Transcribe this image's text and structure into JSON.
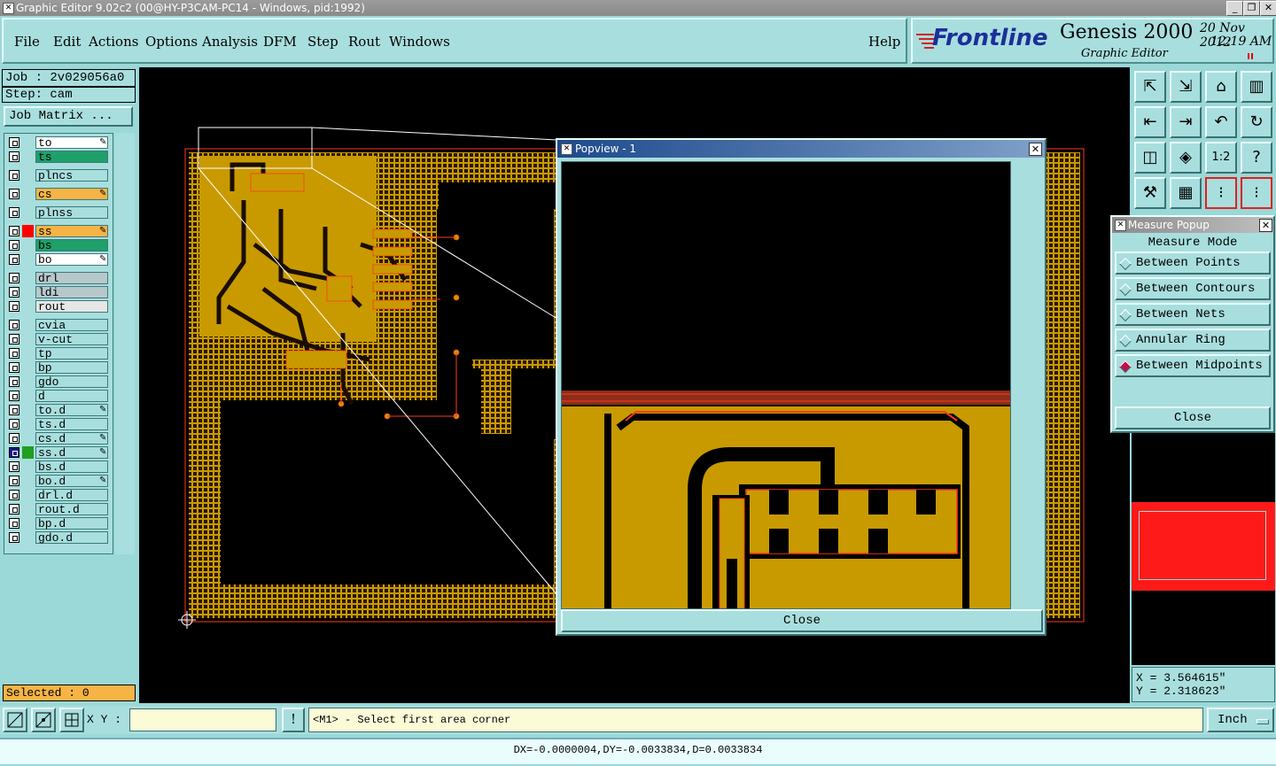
{
  "window": {
    "title": "Graphic Editor 9.02c2 (00@HY-P3CAM-PC14 - Windows, pid:1992)"
  },
  "menu": [
    {
      "label": "File"
    },
    {
      "label": "Edit"
    },
    {
      "label": "Actions"
    },
    {
      "label": "Options"
    },
    {
      "label": "Analysis"
    },
    {
      "label": "DFM"
    },
    {
      "label": "Step"
    },
    {
      "label": "Rout"
    },
    {
      "label": "Windows"
    }
  ],
  "help_label": "Help",
  "brand": {
    "logo": "Frontline",
    "product": "Genesis 2000",
    "subtitle": "Graphic Editor",
    "date": "20 Nov 2012",
    "time": "12:19 AM"
  },
  "job": {
    "job_label": "Job : 2v029056a0",
    "step_label": "Step: cam",
    "matrix_button": "Job Matrix ..."
  },
  "layers": [
    {
      "name": "to",
      "bg": "#ffffff",
      "icon": "pen-icon"
    },
    {
      "name": "ts",
      "bg": "#1fa06a",
      "icon": ""
    },
    {
      "name": "plncs",
      "bg": "#a9dede",
      "icon": ""
    },
    {
      "name": "cs",
      "bg": "#f5b445",
      "icon": "pen-icon"
    },
    {
      "name": "plnss",
      "bg": "#a9dede",
      "icon": ""
    },
    {
      "name": "ss",
      "bg": "#f5b445",
      "icon": "pen-icon",
      "marker": "#ff0000"
    },
    {
      "name": "bs",
      "bg": "#1fa06a",
      "icon": ""
    },
    {
      "name": "bo",
      "bg": "#ffffff",
      "icon": "pen-icon"
    },
    {
      "name": "drl",
      "bg": "#b7c8cc",
      "icon": ""
    },
    {
      "name": "ldi",
      "bg": "#b7c8cc",
      "icon": ""
    },
    {
      "name": "rout",
      "bg": "#e6e6e6",
      "icon": ""
    },
    {
      "name": "cvia",
      "bg": "#a9dede",
      "icon": ""
    },
    {
      "name": "v-cut",
      "bg": "#a9dede",
      "icon": ""
    },
    {
      "name": "tp",
      "bg": "#a9dede",
      "icon": ""
    },
    {
      "name": "bp",
      "bg": "#a9dede",
      "icon": ""
    },
    {
      "name": "gdo",
      "bg": "#a9dede",
      "icon": ""
    },
    {
      "name": "d",
      "bg": "#a9dede",
      "icon": ""
    },
    {
      "name": "to.d",
      "bg": "#a9dede",
      "icon": "pen-icon"
    },
    {
      "name": "ts.d",
      "bg": "#a9dede",
      "icon": ""
    },
    {
      "name": "cs.d",
      "bg": "#a9dede",
      "icon": "pen-icon"
    },
    {
      "name": "ss.d",
      "bg": "#a9dede",
      "icon": "pen-icon",
      "marker": "#1fa020",
      "active": true
    },
    {
      "name": "bs.d",
      "bg": "#a9dede",
      "icon": ""
    },
    {
      "name": "bo.d",
      "bg": "#a9dede",
      "icon": "pen-icon"
    },
    {
      "name": "drl.d",
      "bg": "#a9dede",
      "icon": ""
    },
    {
      "name": "rout.d",
      "bg": "#a9dede",
      "icon": ""
    },
    {
      "name": "bp.d",
      "bg": "#a9dede",
      "icon": ""
    },
    {
      "name": "gdo.d",
      "bg": "#a9dede",
      "icon": ""
    }
  ],
  "selected_label": "Selected : 0",
  "popview": {
    "title": "Popview - 1",
    "close_label": "Close"
  },
  "measure": {
    "title": "Measure Popup",
    "mode_label": "Measure Mode",
    "options": [
      {
        "label": "Between Points",
        "selected": false
      },
      {
        "label": "Between Contours",
        "selected": false
      },
      {
        "label": "Between Nets",
        "selected": false
      },
      {
        "label": "Annular Ring",
        "selected": false
      },
      {
        "label": "Between Midpoints",
        "selected": true
      }
    ],
    "close_label": "Close"
  },
  "coords": {
    "x_label": "X = 3.564615\"",
    "y_label": "Y = 2.318623\""
  },
  "command": {
    "xy_label": "X Y :",
    "xy_value": "",
    "prompt": "<M1> - Select first area corner",
    "units": "Inch"
  },
  "status": {
    "text": "DX=-0.0000004,DY=-0.0033834,D=0.0033834"
  },
  "colors": {
    "copper": "#c89a00",
    "outline": "#ff3a1a",
    "teal": "#a9dede",
    "canvas": "#000000"
  }
}
